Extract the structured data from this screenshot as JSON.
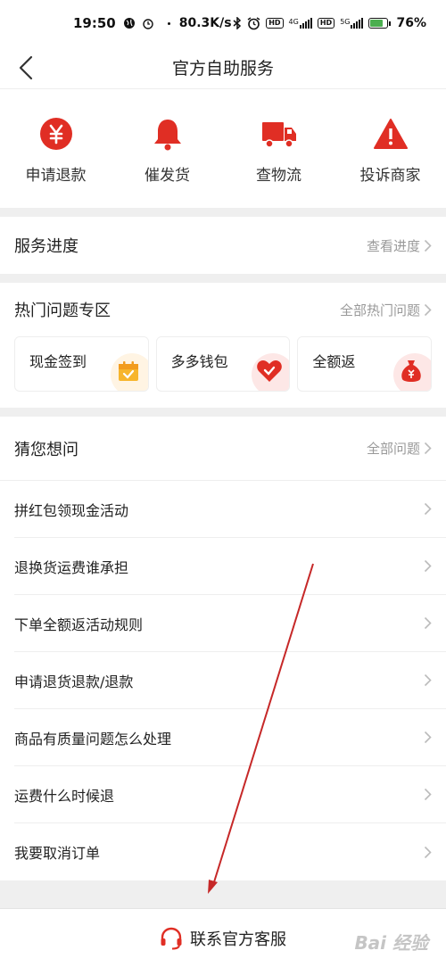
{
  "status": {
    "time": "19:50",
    "speed": "80.3K/s",
    "battery": "76%",
    "net1": "4G",
    "net2": "5G"
  },
  "nav": {
    "title": "官方自助服务"
  },
  "quick_actions": [
    {
      "label": "申请退款",
      "icon": "yuan-icon"
    },
    {
      "label": "催发货",
      "icon": "bell-icon"
    },
    {
      "label": "查物流",
      "icon": "truck-icon"
    },
    {
      "label": "投诉商家",
      "icon": "warning-icon"
    }
  ],
  "service_progress": {
    "title": "服务进度",
    "action": "查看进度"
  },
  "hot": {
    "title": "热门问题专区",
    "more": "全部热门问题",
    "cards": [
      {
        "label": "现金签到",
        "icon": "calendar-icon"
      },
      {
        "label": "多多钱包",
        "icon": "heart-wallet-icon"
      },
      {
        "label": "全额返",
        "icon": "money-bag-icon"
      }
    ]
  },
  "faq": {
    "title": "猜您想问",
    "more": "全部问题",
    "items": [
      "拼红包领现金活动",
      "退换货运费谁承担",
      "下单全额返活动规则",
      "申请退货退款/退款",
      "商品有质量问题怎么处理",
      "运费什么时候退",
      "我要取消订单"
    ]
  },
  "contact": {
    "label": "联系官方客服",
    "icon": "headset-icon"
  },
  "watermark": "Bai 经验",
  "colors": {
    "accent": "#e02e24",
    "annotation_arrow": "#c62828",
    "page_bg": "#efefef"
  }
}
